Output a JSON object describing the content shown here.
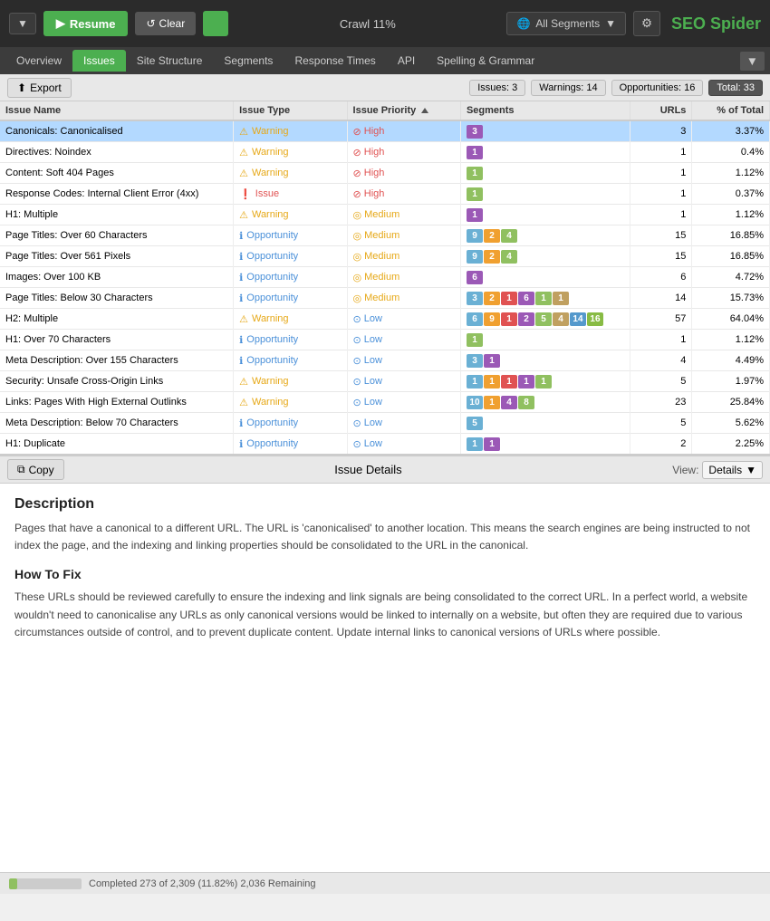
{
  "toolbar": {
    "resume_label": "Resume",
    "clear_label": "Clear",
    "crawl_progress": "Crawl 11%",
    "segments_label": "All Segments",
    "seo_spider": "SEO Spider"
  },
  "nav_tabs": [
    {
      "id": "overview",
      "label": "Overview",
      "active": false
    },
    {
      "id": "issues",
      "label": "Issues",
      "active": true
    },
    {
      "id": "site-structure",
      "label": "Site Structure",
      "active": false
    },
    {
      "id": "segments",
      "label": "Segments",
      "active": false
    },
    {
      "id": "response-times",
      "label": "Response Times",
      "active": false
    },
    {
      "id": "api",
      "label": "API",
      "active": false
    },
    {
      "id": "spelling",
      "label": "Spelling & Grammar",
      "active": false
    }
  ],
  "toolbar2": {
    "export_label": "Export",
    "issues_badge": "Issues: 3",
    "warnings_badge": "Warnings: 14",
    "opportunities_badge": "Opportunities: 16",
    "total_badge": "Total: 33"
  },
  "table": {
    "columns": [
      "Issue Name",
      "Issue Type",
      "Issue Priority",
      "Segments",
      "URLs",
      "% of Total"
    ],
    "rows": [
      {
        "name": "Canonicals: Canonicalised",
        "type": "Warning",
        "type_class": "warning",
        "priority": "High",
        "priority_class": "high",
        "segments": [
          {
            "value": "3",
            "color": "#9b59b6"
          }
        ],
        "urls": "3",
        "pct": "3.37%",
        "selected": true
      },
      {
        "name": "Directives: Noindex",
        "type": "Warning",
        "type_class": "warning",
        "priority": "High",
        "priority_class": "high",
        "segments": [
          {
            "value": "1",
            "color": "#9b59b6"
          }
        ],
        "urls": "1",
        "pct": "0.4%",
        "selected": false
      },
      {
        "name": "Content: Soft 404 Pages",
        "type": "Warning",
        "type_class": "warning",
        "priority": "High",
        "priority_class": "high",
        "segments": [
          {
            "value": "1",
            "color": "#90c060"
          }
        ],
        "urls": "1",
        "pct": "1.12%",
        "selected": false
      },
      {
        "name": "Response Codes: Internal Client Error (4xx)",
        "type": "Issue",
        "type_class": "issue",
        "priority": "High",
        "priority_class": "high",
        "segments": [
          {
            "value": "1",
            "color": "#90c060"
          }
        ],
        "urls": "1",
        "pct": "0.37%",
        "selected": false
      },
      {
        "name": "H1: Multiple",
        "type": "Warning",
        "type_class": "warning",
        "priority": "Medium",
        "priority_class": "medium",
        "segments": [
          {
            "value": "1",
            "color": "#9b59b6"
          }
        ],
        "urls": "1",
        "pct": "1.12%",
        "selected": false
      },
      {
        "name": "Page Titles: Over 60 Characters",
        "type": "Opportunity",
        "type_class": "opportunity",
        "priority": "Medium",
        "priority_class": "medium",
        "segments": [
          {
            "value": "9",
            "color": "#6ab0d4"
          },
          {
            "value": "2",
            "color": "#f0a030"
          },
          {
            "value": "4",
            "color": "#90c060"
          }
        ],
        "urls": "15",
        "pct": "16.85%",
        "selected": false
      },
      {
        "name": "Page Titles: Over 561 Pixels",
        "type": "Opportunity",
        "type_class": "opportunity",
        "priority": "Medium",
        "priority_class": "medium",
        "segments": [
          {
            "value": "9",
            "color": "#6ab0d4"
          },
          {
            "value": "2",
            "color": "#f0a030"
          },
          {
            "value": "4",
            "color": "#90c060"
          }
        ],
        "urls": "15",
        "pct": "16.85%",
        "selected": false
      },
      {
        "name": "Images: Over 100 KB",
        "type": "Opportunity",
        "type_class": "opportunity",
        "priority": "Medium",
        "priority_class": "medium",
        "segments": [
          {
            "value": "6",
            "color": "#9b59b6"
          }
        ],
        "urls": "6",
        "pct": "4.72%",
        "selected": false
      },
      {
        "name": "Page Titles: Below 30 Characters",
        "type": "Opportunity",
        "type_class": "opportunity",
        "priority": "Medium",
        "priority_class": "medium",
        "segments": [
          {
            "value": "3",
            "color": "#6ab0d4"
          },
          {
            "value": "2",
            "color": "#f0a030"
          },
          {
            "value": "1",
            "color": "#e05252"
          },
          {
            "value": "6",
            "color": "#9b59b6"
          },
          {
            "value": "1",
            "color": "#90c060"
          },
          {
            "value": "1",
            "color": "#c0a060"
          }
        ],
        "urls": "14",
        "pct": "15.73%",
        "selected": false
      },
      {
        "name": "H2: Multiple",
        "type": "Warning",
        "type_class": "warning",
        "priority": "Low",
        "priority_class": "low",
        "segments": [
          {
            "value": "6",
            "color": "#6ab0d4"
          },
          {
            "value": "9",
            "color": "#f0a030"
          },
          {
            "value": "1",
            "color": "#e05252"
          },
          {
            "value": "2",
            "color": "#9b59b6"
          },
          {
            "value": "5",
            "color": "#90c060"
          },
          {
            "value": "4",
            "color": "#c0a060"
          },
          {
            "value": "14",
            "color": "#5599cc"
          },
          {
            "value": "16",
            "color": "#88bb44"
          }
        ],
        "urls": "57",
        "pct": "64.04%",
        "selected": false
      },
      {
        "name": "H1: Over 70 Characters",
        "type": "Opportunity",
        "type_class": "opportunity",
        "priority": "Low",
        "priority_class": "low",
        "segments": [
          {
            "value": "1",
            "color": "#90c060"
          }
        ],
        "urls": "1",
        "pct": "1.12%",
        "selected": false
      },
      {
        "name": "Meta Description: Over 155 Characters",
        "type": "Opportunity",
        "type_class": "opportunity",
        "priority": "Low",
        "priority_class": "low",
        "segments": [
          {
            "value": "3",
            "color": "#6ab0d4"
          },
          {
            "value": "1",
            "color": "#9b59b6"
          }
        ],
        "urls": "4",
        "pct": "4.49%",
        "selected": false
      },
      {
        "name": "Security: Unsafe Cross-Origin Links",
        "type": "Warning",
        "type_class": "warning",
        "priority": "Low",
        "priority_class": "low",
        "segments": [
          {
            "value": "1",
            "color": "#6ab0d4"
          },
          {
            "value": "1",
            "color": "#f0a030"
          },
          {
            "value": "1",
            "color": "#e05252"
          },
          {
            "value": "1",
            "color": "#9b59b6"
          },
          {
            "value": "1",
            "color": "#90c060"
          }
        ],
        "urls": "5",
        "pct": "1.97%",
        "selected": false
      },
      {
        "name": "Links: Pages With High External Outlinks",
        "type": "Warning",
        "type_class": "warning",
        "priority": "Low",
        "priority_class": "low",
        "segments": [
          {
            "value": "10",
            "color": "#6ab0d4"
          },
          {
            "value": "1",
            "color": "#f0a030"
          },
          {
            "value": "4",
            "color": "#9b59b6"
          },
          {
            "value": "8",
            "color": "#90c060"
          }
        ],
        "urls": "23",
        "pct": "25.84%",
        "selected": false
      },
      {
        "name": "Meta Description: Below 70 Characters",
        "type": "Opportunity",
        "type_class": "opportunity",
        "priority": "Low",
        "priority_class": "low",
        "segments": [
          {
            "value": "5",
            "color": "#6ab0d4"
          }
        ],
        "urls": "5",
        "pct": "5.62%",
        "selected": false
      },
      {
        "name": "H1: Duplicate",
        "type": "Opportunity",
        "type_class": "opportunity",
        "priority": "Low",
        "priority_class": "low",
        "segments": [
          {
            "value": "1",
            "color": "#6ab0d4"
          },
          {
            "value": "1",
            "color": "#9b59b6"
          }
        ],
        "urls": "2",
        "pct": "2.25%",
        "selected": false
      }
    ]
  },
  "issue_details": {
    "panel_title": "Issue Details",
    "copy_label": "Copy",
    "view_label": "View:",
    "view_option": "Details",
    "description_heading": "Description",
    "description_text": "Pages that have a canonical to a different URL. The URL is 'canonicalised' to another location. This means the search engines are being instructed to not index the page, and the indexing and linking properties should be consolidated to the URL in the canonical.",
    "how_to_fix_heading": "How To Fix",
    "how_to_fix_text": "These URLs should be reviewed carefully to ensure the indexing and link signals are being consolidated to the correct URL. In a perfect world, a website wouldn't need to canonicalise any URLs as only canonical versions would be linked to internally on a website, but often they are required due to various circumstances outside of control, and to prevent duplicate content. Update internal links to canonical versions of URLs where possible."
  },
  "status_bar": {
    "text": "Completed 273 of 2,309 (11.82%) 2,036 Remaining",
    "progress_pct": 11.82
  }
}
